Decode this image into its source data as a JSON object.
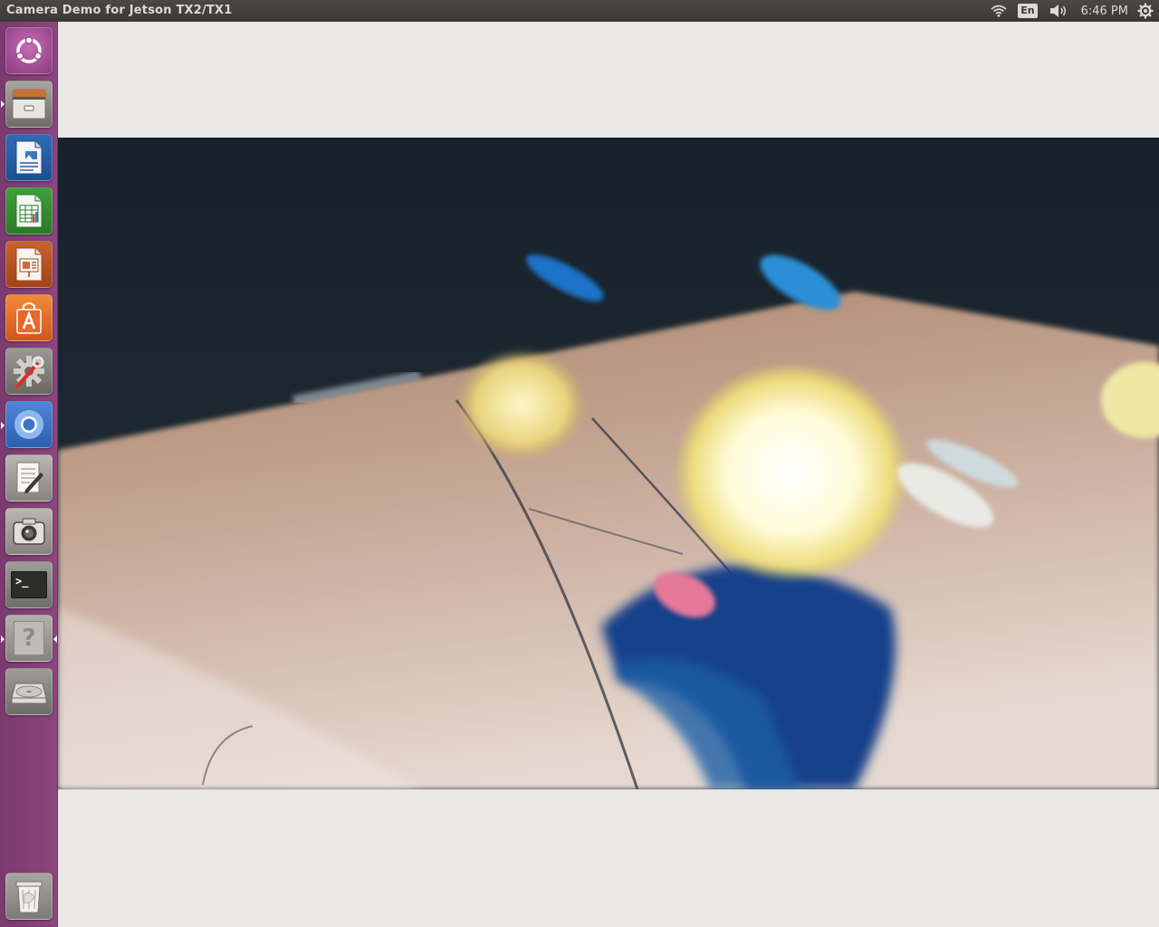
{
  "window": {
    "title": "Camera Demo for Jetson TX2/TX1"
  },
  "panel": {
    "indicators": [
      {
        "icon": "wifi-icon"
      },
      {
        "icon": "keyboard-layout",
        "label": "En"
      },
      {
        "icon": "volume-icon"
      }
    ],
    "clock": "6:46 PM",
    "settings_icon": "gear-icon"
  },
  "launcher": {
    "items": [
      {
        "name": "ubuntu-dash",
        "icon": "ubuntu-logo-icon"
      },
      {
        "name": "files",
        "icon": "file-cabinet-icon"
      },
      {
        "name": "libreoffice-writer",
        "icon": "document-icon"
      },
      {
        "name": "libreoffice-calc",
        "icon": "spreadsheet-icon"
      },
      {
        "name": "libreoffice-impress",
        "icon": "presentation-icon"
      },
      {
        "name": "ubuntu-software",
        "icon": "shopping-bag-icon"
      },
      {
        "name": "system-settings",
        "icon": "settings-wrench-icon"
      },
      {
        "name": "chromium",
        "icon": "browser-icon"
      },
      {
        "name": "text-editor",
        "icon": "text-editor-icon"
      },
      {
        "name": "camera",
        "icon": "camera-icon"
      },
      {
        "name": "terminal",
        "icon": "terminal-icon",
        "prompt": ">_"
      },
      {
        "name": "help",
        "icon": "help-icon",
        "glyph": "?"
      },
      {
        "name": "disk",
        "icon": "disk-drive-icon"
      },
      {
        "name": "trash",
        "icon": "trash-icon"
      }
    ]
  },
  "colors": {
    "panel_bg": "#3c3b37",
    "launcher_bg": "#813f76",
    "window_bg": "#e8e7e5"
  }
}
